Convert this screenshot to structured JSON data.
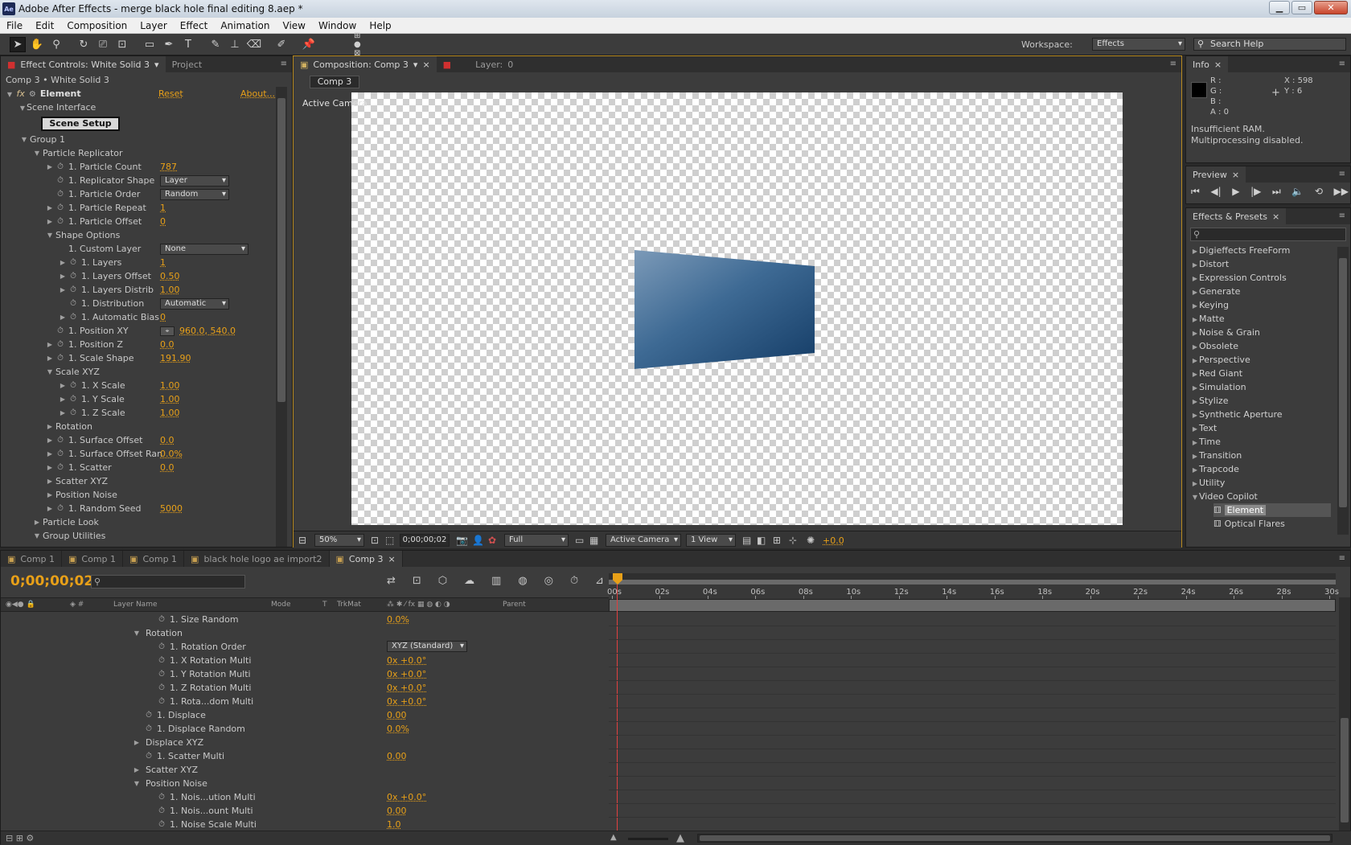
{
  "app": {
    "title": "Adobe After Effects - merge black hole final editing 8.aep *",
    "icon": "Ae"
  },
  "menu": [
    "File",
    "Edit",
    "Composition",
    "Layer",
    "Effect",
    "Animation",
    "View",
    "Window",
    "Help"
  ],
  "toolbar": {
    "tools": [
      "selection-tool",
      "hand-tool",
      "zoom-tool",
      "rotate-tool",
      "camera-orbit-tool",
      "pan-behind-tool",
      "rectangle-tool",
      "pen-tool",
      "type-tool",
      "brush-tool",
      "clone-stamp-tool",
      "eraser-tool",
      "roto-brush-tool",
      "puppet-pin-tool"
    ],
    "workspace_label": "Workspace:",
    "workspace_value": "Effects",
    "search_placeholder": "Search Help"
  },
  "effect_controls": {
    "tab_label": "Effect Controls: White Solid 3",
    "tab_project": "Project",
    "breadcrumb": "Comp 3 • White Solid 3",
    "effect_name": "Element",
    "reset": "Reset",
    "about": "About...",
    "scene_interface": "Scene Interface",
    "scene_setup": "Scene Setup",
    "rows": [
      {
        "indent": 1,
        "tri": "▼",
        "sw": false,
        "label": "Group 1",
        "value": ""
      },
      {
        "indent": 2,
        "tri": "▼",
        "sw": false,
        "label": "Particle Replicator",
        "value": ""
      },
      {
        "indent": 3,
        "tri": "▶",
        "sw": true,
        "label": "1. Particle Count",
        "value": "787"
      },
      {
        "indent": 3,
        "tri": "",
        "sw": true,
        "label": "1. Replicator Shape",
        "dropdown": "Layer",
        "dd_w": 86
      },
      {
        "indent": 3,
        "tri": "",
        "sw": true,
        "label": "1. Particle Order",
        "dropdown": "Random",
        "dd_w": 86
      },
      {
        "indent": 3,
        "tri": "▶",
        "sw": true,
        "label": "1. Particle Repeat",
        "value": "1"
      },
      {
        "indent": 3,
        "tri": "▶",
        "sw": true,
        "label": "1. Particle Offset",
        "value": "0"
      },
      {
        "indent": 3,
        "tri": "▼",
        "sw": false,
        "label": "Shape Options",
        "value": ""
      },
      {
        "indent": 4,
        "tri": "",
        "sw": false,
        "label": "1. Custom Layer",
        "dropdown": "None",
        "dd_w": 110
      },
      {
        "indent": 4,
        "tri": "▶",
        "sw": true,
        "label": "1. Layers",
        "value": "1"
      },
      {
        "indent": 4,
        "tri": "▶",
        "sw": true,
        "label": "1. Layers Offset",
        "value": "0.50"
      },
      {
        "indent": 4,
        "tri": "▶",
        "sw": true,
        "label": "1. Layers Distrib",
        "value": "1.00"
      },
      {
        "indent": 4,
        "tri": "",
        "sw": true,
        "label": "1. Distribution",
        "dropdown": "Automatic",
        "dd_w": 86
      },
      {
        "indent": 4,
        "tri": "▶",
        "sw": true,
        "label": "1. Automatic Bias",
        "value": "0"
      },
      {
        "indent": 3,
        "tri": "",
        "sw": true,
        "label": "1. Position XY",
        "point": "960.0, 540.0"
      },
      {
        "indent": 3,
        "tri": "▶",
        "sw": true,
        "label": "1. Position Z",
        "value": "0.0"
      },
      {
        "indent": 3,
        "tri": "▶",
        "sw": true,
        "label": "1. Scale Shape",
        "value": "191.90"
      },
      {
        "indent": 3,
        "tri": "▼",
        "sw": false,
        "label": "Scale XYZ",
        "value": ""
      },
      {
        "indent": 4,
        "tri": "▶",
        "sw": true,
        "label": "1. X Scale",
        "value": "1.00"
      },
      {
        "indent": 4,
        "tri": "▶",
        "sw": true,
        "label": "1. Y Scale",
        "value": "1.00"
      },
      {
        "indent": 4,
        "tri": "▶",
        "sw": true,
        "label": "1. Z Scale",
        "value": "1.00"
      },
      {
        "indent": 3,
        "tri": "▶",
        "sw": false,
        "label": "Rotation",
        "value": ""
      },
      {
        "indent": 3,
        "tri": "▶",
        "sw": true,
        "label": "1. Surface Offset",
        "value": "0.0"
      },
      {
        "indent": 3,
        "tri": "▶",
        "sw": true,
        "label": "1. Surface Offset Ran",
        "value": "0.0%"
      },
      {
        "indent": 3,
        "tri": "▶",
        "sw": true,
        "label": "1. Scatter",
        "value": "0.0"
      },
      {
        "indent": 3,
        "tri": "▶",
        "sw": false,
        "label": "Scatter XYZ",
        "value": ""
      },
      {
        "indent": 3,
        "tri": "▶",
        "sw": false,
        "label": "Position Noise",
        "value": ""
      },
      {
        "indent": 3,
        "tri": "▶",
        "sw": true,
        "label": "1. Random Seed",
        "value": "5000"
      },
      {
        "indent": 2,
        "tri": "▶",
        "sw": false,
        "label": "Particle Look",
        "value": ""
      },
      {
        "indent": 2,
        "tri": "▼",
        "sw": false,
        "label": "Group Utilities",
        "value": ""
      }
    ]
  },
  "composition": {
    "tab_label": "Composition: Comp 3",
    "layer_tab": "Layer:",
    "layer_value": "0",
    "comp_button": "Comp 3",
    "view_label": "Active Camera",
    "zoom": "50%",
    "timecode": "0;00;00;02",
    "resolution": "Full",
    "camera": "Active Camera",
    "views": "1 View",
    "exposure": "+0.0"
  },
  "info": {
    "tab": "Info",
    "r": "R :",
    "g": "G :",
    "b": "B :",
    "a": "A : 0",
    "x": "X : 598",
    "y": "Y : 6",
    "message1": "Insufficient RAM.",
    "message2": "Multiprocessing disabled."
  },
  "preview": {
    "tab": "Preview"
  },
  "effects_presets": {
    "tab": "Effects & Presets",
    "search_placeholder": "",
    "items": [
      {
        "tri": "▶",
        "label": "Digieffects FreeForm"
      },
      {
        "tri": "▶",
        "label": "Distort"
      },
      {
        "tri": "▶",
        "label": "Expression Controls"
      },
      {
        "tri": "▶",
        "label": "Generate"
      },
      {
        "tri": "▶",
        "label": "Keying"
      },
      {
        "tri": "▶",
        "label": "Matte"
      },
      {
        "tri": "▶",
        "label": "Noise & Grain"
      },
      {
        "tri": "▶",
        "label": "Obsolete"
      },
      {
        "tri": "▶",
        "label": "Perspective"
      },
      {
        "tri": "▶",
        "label": "Red Giant"
      },
      {
        "tri": "▶",
        "label": "Simulation"
      },
      {
        "tri": "▶",
        "label": "Stylize"
      },
      {
        "tri": "▶",
        "label": "Synthetic Aperture"
      },
      {
        "tri": "▶",
        "label": "Text"
      },
      {
        "tri": "▶",
        "label": "Time"
      },
      {
        "tri": "▶",
        "label": "Transition"
      },
      {
        "tri": "▶",
        "label": "Trapcode"
      },
      {
        "tri": "▶",
        "label": "Utility"
      },
      {
        "tri": "▼",
        "label": "Video Copilot"
      }
    ],
    "children": [
      "Element",
      "Optical Flares"
    ]
  },
  "timeline": {
    "tabs": [
      "Comp 1",
      "Comp 1",
      "Comp 1",
      "black hole logo ae import2",
      "Comp 3"
    ],
    "timecode": "0;00;00;02",
    "search_placeholder": "",
    "headers": {
      "layer_name": "Layer Name",
      "mode": "Mode",
      "t": "T",
      "trkmat": "TrkMat",
      "parent": "Parent"
    },
    "ruler": [
      "00s",
      "02s",
      "04s",
      "06s",
      "08s",
      "10s",
      "12s",
      "14s",
      "16s",
      "18s",
      "20s",
      "22s",
      "24s",
      "26s",
      "28s",
      "30s"
    ],
    "rows": [
      {
        "indent": 2,
        "tri": "",
        "sw": true,
        "label": "1. Size Random",
        "value": "0.0%"
      },
      {
        "indent": 1,
        "tri": "▼",
        "sw": false,
        "label": "Rotation",
        "value": ""
      },
      {
        "indent": 2,
        "tri": "",
        "sw": true,
        "label": "1. Rotation Order",
        "dropdown": "XYZ (Standard)"
      },
      {
        "indent": 2,
        "tri": "",
        "sw": true,
        "label": "1. X Rotation Multi",
        "value": "0x +0.0°"
      },
      {
        "indent": 2,
        "tri": "",
        "sw": true,
        "label": "1. Y Rotation Multi",
        "value": "0x +0.0°"
      },
      {
        "indent": 2,
        "tri": "",
        "sw": true,
        "label": "1. Z Rotation Multi",
        "value": "0x +0.0°"
      },
      {
        "indent": 2,
        "tri": "",
        "sw": true,
        "label": "1. Rota...dom Multi",
        "value": "0x +0.0°"
      },
      {
        "indent": 1,
        "tri": "",
        "sw": true,
        "label": "1. Displace",
        "value": "0.00"
      },
      {
        "indent": 1,
        "tri": "",
        "sw": true,
        "label": "1. Displace Random",
        "value": "0.0%"
      },
      {
        "indent": 1,
        "tri": "▶",
        "sw": false,
        "label": "Displace XYZ",
        "value": ""
      },
      {
        "indent": 1,
        "tri": "",
        "sw": true,
        "label": "1. Scatter Multi",
        "value": "0.00"
      },
      {
        "indent": 1,
        "tri": "▶",
        "sw": false,
        "label": "Scatter XYZ",
        "value": ""
      },
      {
        "indent": 1,
        "tri": "▼",
        "sw": false,
        "label": "Position Noise",
        "value": ""
      },
      {
        "indent": 2,
        "tri": "",
        "sw": true,
        "label": "1. Nois...ution Multi",
        "value": "0x +0.0°"
      },
      {
        "indent": 2,
        "tri": "",
        "sw": true,
        "label": "1. Nois...ount Multi",
        "value": "0.00"
      },
      {
        "indent": 2,
        "tri": "",
        "sw": true,
        "label": "1. Noise Scale Multi",
        "value": "1.0"
      }
    ]
  },
  "colors": {
    "accent": "#e8a018",
    "panel": "#3c3c3c",
    "dark": "#2a2a2a",
    "playhead": "#e04040"
  }
}
